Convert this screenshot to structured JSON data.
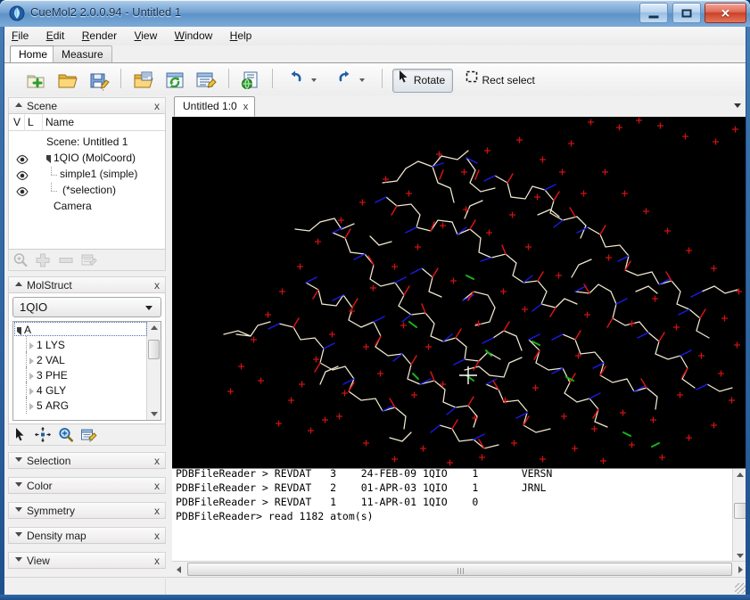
{
  "window": {
    "title": "CueMol2 2.0.0.94 - Untitled 1",
    "icon": "cuemol-app-icon",
    "minimize_label": "Minimize",
    "maximize_label": "Maximize",
    "close_label": "Close"
  },
  "menu": {
    "items": [
      {
        "label": "File",
        "mnemonic": "F"
      },
      {
        "label": "Edit",
        "mnemonic": "E"
      },
      {
        "label": "Render",
        "mnemonic": "R"
      },
      {
        "label": "View",
        "mnemonic": "V"
      },
      {
        "label": "Window",
        "mnemonic": "W"
      },
      {
        "label": "Help",
        "mnemonic": "H"
      }
    ]
  },
  "ribbon_tabs": [
    {
      "label": "Home",
      "active": true
    },
    {
      "label": "Measure",
      "active": false
    }
  ],
  "toolbar": {
    "buttons": [
      {
        "name": "new-scene-icon",
        "label": "New scene"
      },
      {
        "name": "open-folder-icon",
        "label": "Open"
      },
      {
        "name": "save-scene-icon",
        "label": "Save scene"
      },
      {
        "name": "open-object-icon",
        "label": "Open object"
      },
      {
        "name": "reload-object-icon",
        "label": "Reload object"
      },
      {
        "name": "object-properties-icon",
        "label": "Object properties"
      },
      {
        "name": "render-scene-icon",
        "label": "Render scene"
      }
    ],
    "undo_label": "Undo",
    "redo_label": "Redo",
    "rotate_label": "Rotate",
    "rect_select_label": "Rect select",
    "rotate_active": true
  },
  "sidebar": {
    "scene_panel": {
      "title": "Scene",
      "collapsed": false,
      "close_label": "x",
      "columns": [
        "V",
        "L",
        "Name"
      ],
      "rows": [
        {
          "label": "Scene: Untitled 1",
          "indent": 42,
          "eye": false,
          "expander": false
        },
        {
          "label": "1QIO (MolCoord)",
          "indent": 50,
          "eye": true,
          "expander": true
        },
        {
          "label": "simple1 (simple)",
          "indent": 62,
          "eye": true,
          "expander": false
        },
        {
          "label": "(*selection)",
          "indent": 67,
          "eye": true,
          "expander": false
        },
        {
          "label": "Camera",
          "indent": 50,
          "eye": false,
          "expander": false
        }
      ],
      "footer_buttons": [
        {
          "name": "find-icon",
          "enabled": false
        },
        {
          "name": "add-icon",
          "enabled": false
        },
        {
          "name": "remove-icon",
          "enabled": false
        },
        {
          "name": "properties-icon",
          "enabled": false
        }
      ]
    },
    "molstruct_panel": {
      "title": "MolStruct",
      "collapsed": false,
      "close_label": "x",
      "selected_molecule": "1QIO",
      "chain": "A",
      "residues": [
        {
          "index": "1",
          "name": "LYS"
        },
        {
          "index": "2",
          "name": "VAL"
        },
        {
          "index": "3",
          "name": "PHE"
        },
        {
          "index": "4",
          "name": "GLY"
        },
        {
          "index": "5",
          "name": "ARG"
        }
      ],
      "footer_buttons": [
        {
          "name": "select-arrow-icon",
          "enabled": true
        },
        {
          "name": "center-view-icon",
          "enabled": true
        },
        {
          "name": "zoom-icon",
          "enabled": true
        },
        {
          "name": "properties-icon",
          "enabled": true
        }
      ]
    },
    "collapsed_panels": [
      {
        "title": "Selection",
        "close_label": "x"
      },
      {
        "title": "Color",
        "close_label": "x"
      },
      {
        "title": "Symmetry",
        "close_label": "x"
      },
      {
        "title": "Density map",
        "close_label": "x"
      },
      {
        "title": "View",
        "close_label": "x"
      }
    ]
  },
  "document": {
    "tab_label": "Untitled 1:0",
    "tab_close_label": "x",
    "viewport_background": "#000000",
    "molecule_colors": {
      "carbon": "#f2ead2",
      "nitrogen": "#1515e0",
      "oxygen": "#d81414",
      "sulfur": "#19b319",
      "water": "#cc1111"
    }
  },
  "console": {
    "lines": [
      "PDBFileReader > REVDAT   3    24-FEB-09 1QIO    1       VERSN",
      "PDBFileReader > REVDAT   2    01-APR-03 1QIO    1       JRNL",
      "PDBFileReader > REVDAT   1    11-APR-01 1QIO    0",
      "PDBFileReader> read 1182 atom(s)"
    ]
  },
  "statusbar": {
    "text": ""
  }
}
